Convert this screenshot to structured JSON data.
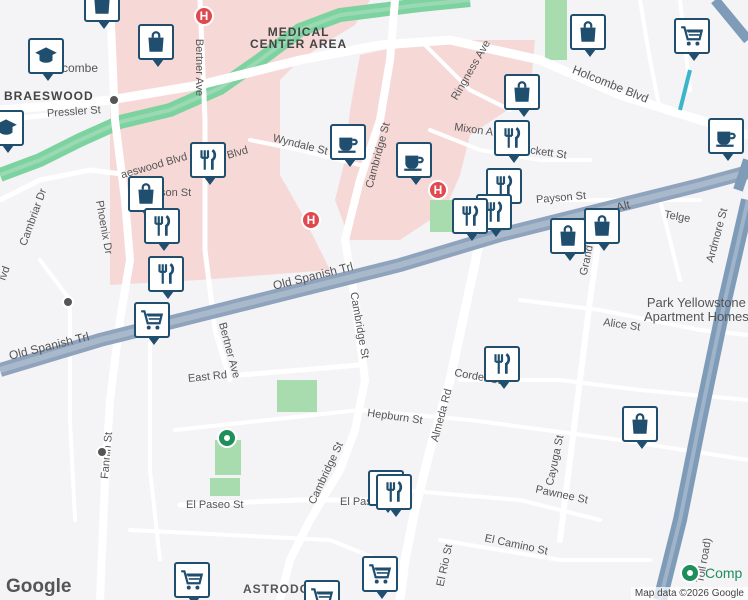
{
  "map": {
    "areas": [
      {
        "key": "medical_center",
        "text": "MEDICAL\nCENTER AREA"
      },
      {
        "key": "braeswood",
        "text": "BRAESWOOD"
      }
    ],
    "streets": {
      "holcombe_left": "Holcombe",
      "holcombe_blvd": "Holcombe Blvd",
      "bertner_top": "Bertner Ave",
      "bertner_bottom": "Bertner Ave",
      "pressler": "Pressler St",
      "wyndale": "Wyndale St",
      "cambridge_top": "Cambridge St",
      "cambridge_mid": "Cambridge St",
      "cambridge_bottom": "Cambridge St",
      "ringness": "Ringness Ave",
      "mixon": "Mixon A",
      "pickett": "ckett St",
      "payson": "Payson St",
      "ipson": "son St",
      "old_spanish_mid": "Old Spanish Trl",
      "old_spanish_left": "Old Spanish Trl",
      "old_spanish_right": "Alt",
      "telge": "Telge",
      "ardmore": "Ardmore St",
      "alice": "Alice St",
      "corder": "Corder St",
      "east_rd": "East Rd",
      "hepburn": "Hepburn St",
      "almeda": "Almeda Rd",
      "fannin": "Fannin St",
      "el_paseo_left": "El Paseo St",
      "el_paseo_mid": "El Pase",
      "pawnee": "Pawnee St",
      "cayuga": "Cayuga St",
      "el_camino": "El Camino St",
      "el_rio": "El Rio St",
      "astrodome": "ASTRODO",
      "phoenix": "Phoenix Dr",
      "cambriar": "Cambriar Dr",
      "grand": "Grand",
      "braes_blvd": "Blvd",
      "braes_blvd_left": "aeswood Blvd",
      "toll": "Toll road)",
      "ivd": "lvd"
    },
    "places": {
      "park_yellowstone_1": "Park Yellowstone",
      "park_yellowstone_2": "Apartment Homes",
      "comp": "Comp"
    },
    "icons": [
      "shopping-bag-icon",
      "restaurant-icon",
      "coffee-icon",
      "grocery-cart-icon",
      "school-icon",
      "hospital-icon",
      "park-icon",
      "bus-stop-icon"
    ],
    "colors": {
      "background": "#f4f3f6",
      "medical_area": "#f6d9d7",
      "bayou": "#7dd3a0",
      "park": "#a8dcae",
      "highway": "#7e9bb8",
      "pin_border": "#1f4e6e",
      "hospital": "#e0494f"
    },
    "logo": "Google",
    "attribution": "Map data ©2026 Google"
  }
}
